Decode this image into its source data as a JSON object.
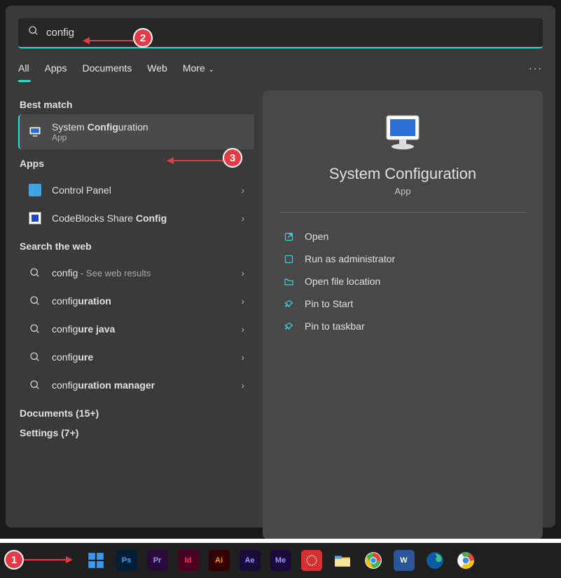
{
  "search": {
    "value": "config"
  },
  "tabs": [
    "All",
    "Apps",
    "Documents",
    "Web",
    "More"
  ],
  "bestMatch": {
    "heading": "Best match",
    "item": {
      "title_pre": "System ",
      "title_bold": "Config",
      "title_post": "uration",
      "sub": "App"
    }
  },
  "apps": {
    "heading": "Apps",
    "items": [
      {
        "label": "Control Panel",
        "bold": ""
      },
      {
        "label": "CodeBlocks Share ",
        "bold": "Config"
      }
    ]
  },
  "web": {
    "heading": "Search the web",
    "items": [
      {
        "pre": "config",
        "bold": "",
        "post": "",
        "suffix": " - See web results"
      },
      {
        "pre": "config",
        "bold": "uration",
        "post": ""
      },
      {
        "pre": "config",
        "bold": "ure java",
        "post": ""
      },
      {
        "pre": "config",
        "bold": "ure",
        "post": ""
      },
      {
        "pre": "config",
        "bold": "uration manager",
        "post": ""
      }
    ]
  },
  "documents": {
    "heading": "Documents (15+)"
  },
  "settings": {
    "heading": "Settings (7+)"
  },
  "detail": {
    "title": "System Configuration",
    "sub": "App",
    "actions": [
      "Open",
      "Run as administrator",
      "Open file location",
      "Pin to Start",
      "Pin to taskbar"
    ]
  },
  "callouts": {
    "c1": "1",
    "c2": "2",
    "c3": "3"
  },
  "taskbar": {
    "ps": "Ps",
    "pr": "Pr",
    "id": "Id",
    "ai": "Ai",
    "ae": "Ae",
    "me": "Me"
  }
}
